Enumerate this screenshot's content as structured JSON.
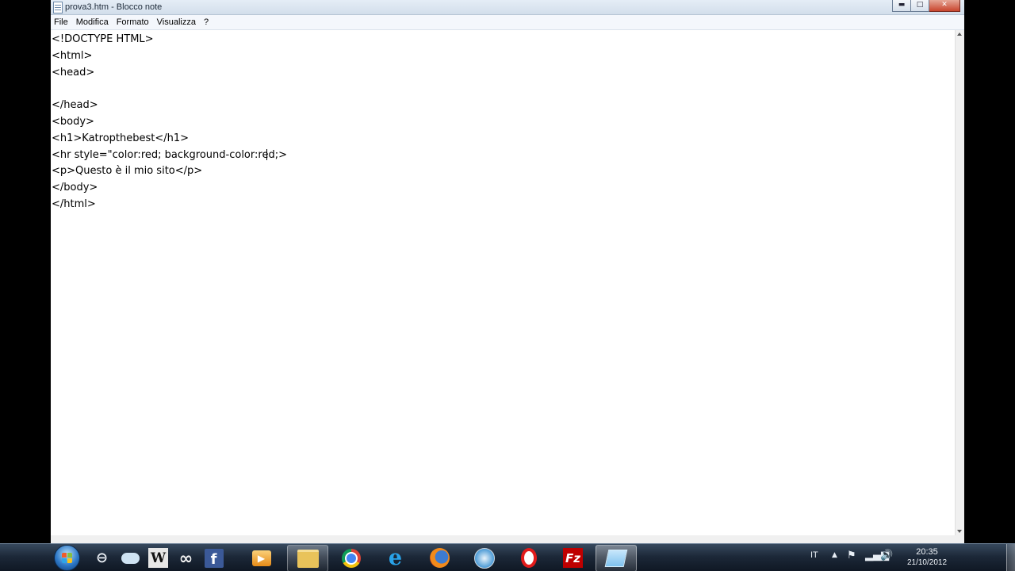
{
  "window": {
    "title": "prova3.htm - Blocco note",
    "icon": "notepad-icon",
    "controls": {
      "minimize": "▬",
      "maximize": "□",
      "close": "✕"
    }
  },
  "menu": {
    "items": [
      {
        "label": "File"
      },
      {
        "label": "Modifica"
      },
      {
        "label": "Formato"
      },
      {
        "label": "Visualizza"
      },
      {
        "label": "?"
      }
    ]
  },
  "editor": {
    "text": "<!DOCTYPE HTML>\n<html>\n<head>\n\n</head>\n<body>\n<h1>Katropthebest</h1>\n<hr style=\"color:red; background-color:red;>\n<p>Questo è il mio sito</p>\n</body>\n</html>"
  },
  "taskbar": {
    "pinned": [
      {
        "name": "computer-icon",
        "glyph": "⊖"
      },
      {
        "name": "weather-cloud-icon",
        "glyph": ""
      },
      {
        "name": "wikipedia-icon",
        "glyph": "W"
      },
      {
        "name": "infinity-icon",
        "glyph": "∞"
      },
      {
        "name": "facebook-icon",
        "glyph": "f"
      },
      {
        "name": "media-player-icon",
        "glyph": "▶"
      },
      {
        "name": "file-explorer-icon",
        "glyph": ""
      },
      {
        "name": "chrome-icon",
        "glyph": ""
      },
      {
        "name": "internet-explorer-icon",
        "glyph": "e"
      },
      {
        "name": "firefox-icon",
        "glyph": ""
      },
      {
        "name": "safari-icon",
        "glyph": ""
      },
      {
        "name": "opera-icon",
        "glyph": ""
      },
      {
        "name": "filezilla-icon",
        "glyph": "Fz"
      },
      {
        "name": "notepad-icon",
        "glyph": ""
      }
    ],
    "tray": {
      "language": "IT",
      "show_hidden": "▲",
      "flag": "⚑",
      "signal": "▂▄▆",
      "volume": "🔊"
    },
    "clock": {
      "time": "20:35",
      "date": "21/10/2012"
    }
  },
  "colors": {
    "window_frame": "#c9d8e8",
    "editor_bg": "#ffffff",
    "taskbar": "#1c2838"
  }
}
